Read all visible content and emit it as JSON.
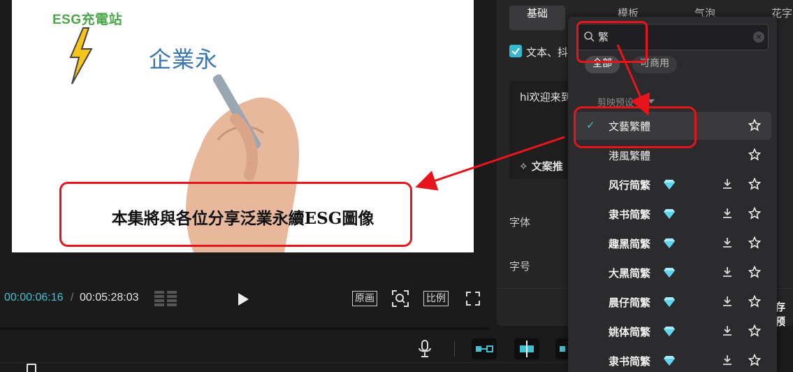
{
  "preview": {
    "logo_text": "ESG充電站",
    "title_text": "企業永",
    "subtitle_text": "本集將與各位分享泛業永續ESG圖像"
  },
  "player": {
    "current_time": "00:00:06:16",
    "separator": "/",
    "total_time": "00:05:28:03",
    "original_label": "原画",
    "ratio_label": "比例"
  },
  "inspector": {
    "tabs": [
      "基础",
      "模板",
      "气泡",
      "花字"
    ],
    "checkbox_label": "文本、抖",
    "text_value": "hi欢迎来到",
    "ai_button_label": "文案推",
    "font_label": "字体",
    "size_label": "字号",
    "save_preset_label": "存预"
  },
  "font_dropdown": {
    "search_value": "繁",
    "filters": [
      "全部",
      "可商用"
    ],
    "section_label": "剪映预设",
    "fonts": [
      {
        "name": "文藝繁體",
        "selected": true,
        "premium": false,
        "downloadable": false
      },
      {
        "name": "港風繁體",
        "selected": false,
        "premium": false,
        "downloadable": false
      },
      {
        "name": "风行简繁",
        "selected": false,
        "premium": true,
        "downloadable": true
      },
      {
        "name": "隶书简繁",
        "selected": false,
        "premium": true,
        "downloadable": true
      },
      {
        "name": "趣黑简繁",
        "selected": false,
        "premium": true,
        "downloadable": true
      },
      {
        "name": "大黑简繁",
        "selected": false,
        "premium": true,
        "downloadable": true
      },
      {
        "name": "晨仔简繁",
        "selected": false,
        "premium": true,
        "downloadable": true
      },
      {
        "name": "姚体简繁",
        "selected": false,
        "premium": true,
        "downloadable": true
      },
      {
        "name": "隶书简繁",
        "selected": false,
        "premium": true,
        "downloadable": true
      }
    ]
  },
  "colors": {
    "accent": "#3fc1d1",
    "annotation": "#e8141b",
    "panel": "#252526",
    "dropdown": "#2b2b2d",
    "premium_gem": "#5fd6f0"
  },
  "icons": [
    "search-icon",
    "clear-icon",
    "check-icon",
    "star-icon",
    "download-icon",
    "diamond-icon",
    "play-icon",
    "fit-icon",
    "fullscreen-icon",
    "microphone-icon"
  ]
}
